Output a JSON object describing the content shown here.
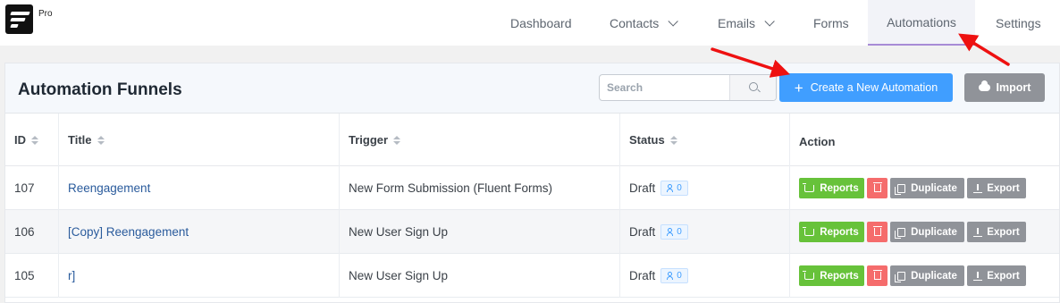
{
  "brand": {
    "badge": "Pro"
  },
  "nav": {
    "dashboard": "Dashboard",
    "contacts": "Contacts",
    "emails": "Emails",
    "forms": "Forms",
    "automations": "Automations",
    "settings": "Settings"
  },
  "page": {
    "title": "Automation Funnels",
    "search_placeholder": "Search",
    "create_label": "Create a New Automation",
    "import_label": "Import"
  },
  "table": {
    "headers": {
      "id": "ID",
      "title": "Title",
      "trigger": "Trigger",
      "status": "Status",
      "action": "Action"
    },
    "rows": [
      {
        "id": "107",
        "title": "Reengagement",
        "trigger": "New Form Submission (Fluent Forms)",
        "status": "Draft",
        "subscribers": "0"
      },
      {
        "id": "106",
        "title": "[Copy] Reengagement",
        "trigger": "New User Sign Up",
        "status": "Draft",
        "subscribers": "0"
      },
      {
        "id": "105",
        "title": "r]",
        "trigger": "New User Sign Up",
        "status": "Draft",
        "subscribers": "0"
      }
    ],
    "actions": {
      "reports": "Reports",
      "duplicate": "Duplicate",
      "export": "Export"
    }
  },
  "colors": {
    "primary": "#409eff",
    "success": "#67c23a",
    "danger": "#f56c6c",
    "info": "#909399",
    "annotation": "#ee1111"
  }
}
